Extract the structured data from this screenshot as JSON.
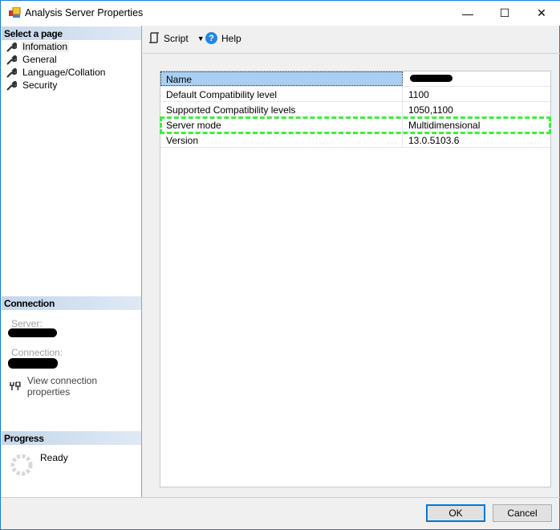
{
  "window": {
    "title": "Analysis Server Properties",
    "minimize": "—",
    "maximize": "☐",
    "close": "✕"
  },
  "sidebar": {
    "select_header": "Select a page",
    "pages": [
      {
        "label": "Infomation",
        "selected": true
      },
      {
        "label": "General"
      },
      {
        "label": "Language/Collation"
      },
      {
        "label": "Security"
      }
    ],
    "connection_header": "Connection",
    "server_label": "Server:",
    "connection_label": "Connection:",
    "view_connection": "View connection properties",
    "progress_header": "Progress",
    "progress_status": "Ready"
  },
  "toolbar": {
    "script": "Script",
    "help": "Help"
  },
  "properties": [
    {
      "name": "Name",
      "value": ""
    },
    {
      "name": "Default Compatibility level",
      "value": "1100"
    },
    {
      "name": "Supported Compatibility levels",
      "value": "1050,1100"
    },
    {
      "name": "Server mode",
      "value": "Multidimensional"
    },
    {
      "name": "Version",
      "value": "13.0.5103.6"
    }
  ],
  "buttons": {
    "ok": "OK",
    "cancel": "Cancel"
  },
  "colors": {
    "highlight": "#3cf03c",
    "selection": "#a8cff2",
    "accent": "#0078d7"
  }
}
